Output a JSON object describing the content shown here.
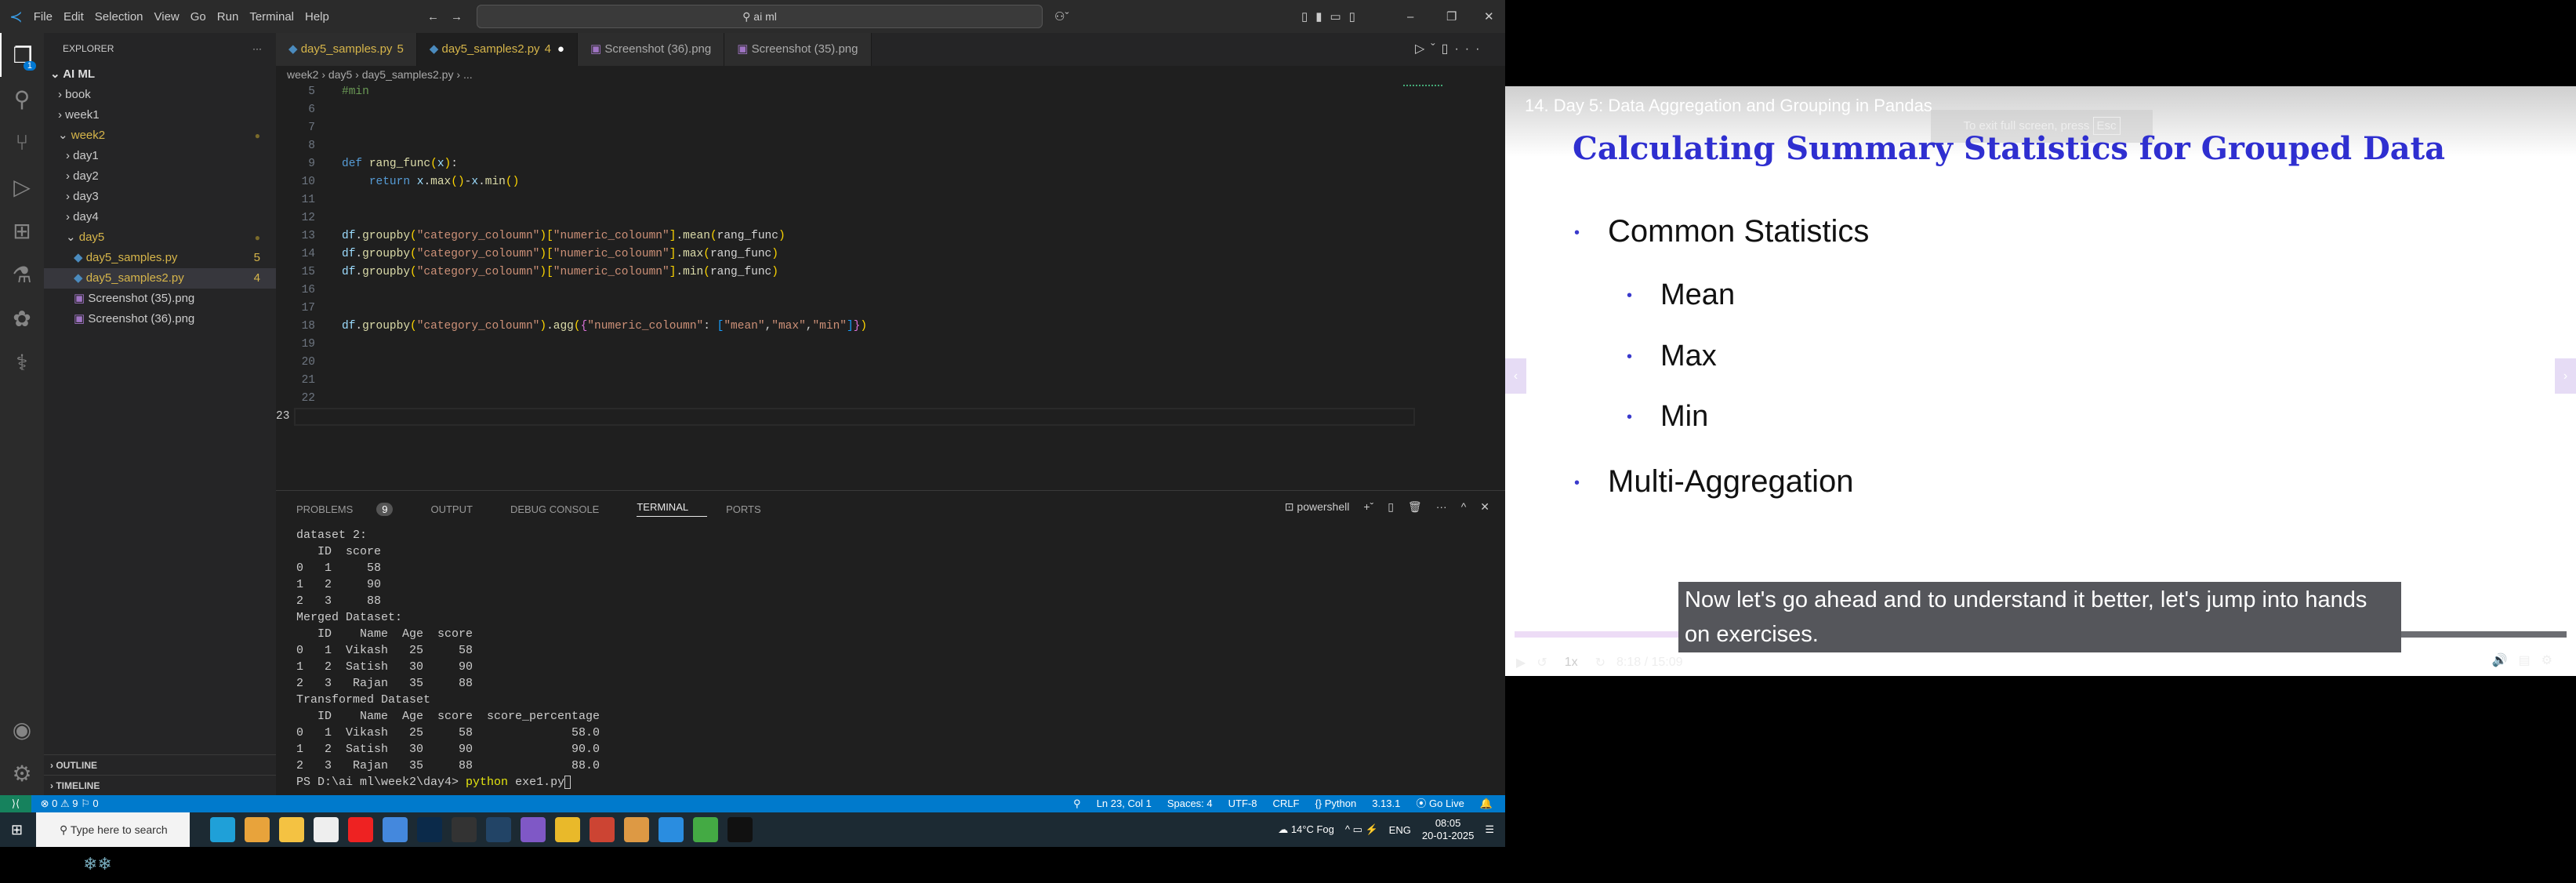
{
  "titlebar": {
    "menu": [
      "File",
      "Edit",
      "Selection",
      "View",
      "Go",
      "Run",
      "Terminal",
      "Help"
    ],
    "search": "ai ml"
  },
  "activity": {
    "explorer_badge": "1"
  },
  "sidebar": {
    "header": "EXPLORER",
    "root": "AI ML",
    "items": [
      {
        "label": "book",
        "depth": 1,
        "type": "folder",
        "open": false
      },
      {
        "label": "week1",
        "depth": 1,
        "type": "folder",
        "open": false
      },
      {
        "label": "week2",
        "depth": 1,
        "type": "folder",
        "open": true,
        "modified": true
      },
      {
        "label": "day1",
        "depth": 2,
        "type": "folder",
        "open": false
      },
      {
        "label": "day2",
        "depth": 2,
        "type": "folder",
        "open": false
      },
      {
        "label": "day3",
        "depth": 2,
        "type": "folder",
        "open": false
      },
      {
        "label": "day4",
        "depth": 2,
        "type": "folder",
        "open": false
      },
      {
        "label": "day5",
        "depth": 2,
        "type": "folder",
        "open": true,
        "modified": true
      },
      {
        "label": "day5_samples.py",
        "depth": 3,
        "type": "py",
        "count": "5"
      },
      {
        "label": "day5_samples2.py",
        "depth": 3,
        "type": "py",
        "count": "4",
        "selected": true
      },
      {
        "label": "Screenshot (35).png",
        "depth": 3,
        "type": "png"
      },
      {
        "label": "Screenshot (36).png",
        "depth": 3,
        "type": "png"
      }
    ],
    "outline": "OUTLINE",
    "timeline": "TIMELINE"
  },
  "tabs": [
    {
      "label": "day5_samples.py",
      "count": "5"
    },
    {
      "label": "day5_samples2.py",
      "count": "4",
      "active": true
    },
    {
      "label": "Screenshot (36).png"
    },
    {
      "label": "Screenshot (35).png"
    }
  ],
  "breadcrumb": [
    "week2",
    "day5",
    "day5_samples2.py",
    "..."
  ],
  "code": [
    {
      "n": "5",
      "html": "<span class='cm'>#min</span>"
    },
    {
      "n": "6",
      "html": ""
    },
    {
      "n": "7",
      "html": ""
    },
    {
      "n": "8",
      "html": ""
    },
    {
      "n": "9",
      "html": "<span class='kw'>def</span> <span class='fn'>rang_func</span><span class='b1'>(</span><span class='vr'>x</span><span class='b1'>)</span>:"
    },
    {
      "n": "10",
      "html": "    <span class='kw'>return</span> <span class='vr'>x</span>.<span class='fn'>max</span><span class='b1'>()</span>-<span class='vr'>x</span>.<span class='fn'>min</span><span class='b1'>()</span>"
    },
    {
      "n": "11",
      "html": ""
    },
    {
      "n": "12",
      "html": ""
    },
    {
      "n": "13",
      "html": "<span class='vr'>df</span>.<span class='fn'>groupby</span><span class='b1'>(</span><span class='str'>\"category_coloumn\"</span><span class='b1'>)[</span><span class='str'>\"numeric_coloumn\"</span><span class='b1'>]</span>.<span class='fn'>mean</span><span class='b1'>(</span>rang_func<span class='b1'>)</span>"
    },
    {
      "n": "14",
      "html": "<span class='vr'>df</span>.<span class='fn'>groupby</span><span class='b1'>(</span><span class='str'>\"category_coloumn\"</span><span class='b1'>)[</span><span class='str'>\"numeric_coloumn\"</span><span class='b1'>]</span>.<span class='fn'>max</span><span class='b1'>(</span>rang_func<span class='b1'>)</span>"
    },
    {
      "n": "15",
      "html": "<span class='vr'>df</span>.<span class='fn'>groupby</span><span class='b1'>(</span><span class='str'>\"category_coloumn\"</span><span class='b1'>)[</span><span class='str'>\"numeric_coloumn\"</span><span class='b1'>]</span>.<span class='fn'>min</span><span class='b1'>(</span>rang_func<span class='b1'>)</span>"
    },
    {
      "n": "16",
      "html": ""
    },
    {
      "n": "17",
      "html": ""
    },
    {
      "n": "18",
      "html": "<span class='vr'>df</span>.<span class='fn'>groupby</span><span class='b1'>(</span><span class='str'>\"category_coloumn\"</span><span class='b1'>)</span>.<span class='fn'>agg</span><span class='b1'>(</span><span class='b2'>{</span><span class='str'>\"numeric_coloumn\"</span>: <span class='b3'>[</span><span class='str'>\"mean\"</span>,<span class='str'>\"max\"</span>,<span class='str'>\"min\"</span><span class='b3'>]</span><span class='b2'>}</span><span class='b1'>)</span>"
    },
    {
      "n": "19",
      "html": ""
    },
    {
      "n": "20",
      "html": ""
    },
    {
      "n": "21",
      "html": ""
    },
    {
      "n": "22",
      "html": ""
    },
    {
      "n": "23",
      "html": "",
      "current": true
    }
  ],
  "panel": {
    "tabs": [
      "PROBLEMS",
      "OUTPUT",
      "DEBUG CONSOLE",
      "TERMINAL",
      "PORTS"
    ],
    "problems_count": "9",
    "active": "TERMINAL",
    "shell": "powershell",
    "terminal": [
      "dataset 2:",
      "   ID  score",
      "0   1     58",
      "1   2     90",
      "2   3     88",
      "Merged Dataset:",
      "   ID    Name  Age  score",
      "0   1  Vikash   25     58",
      "1   2  Satish   30     90",
      "2   3   Rajan   35     88",
      "Transformed Dataset",
      "   ID    Name  Age  score  score_percentage",
      "0   1  Vikash   25     58              58.0",
      "1   2  Satish   30     90              90.0",
      "2   3   Rajan   35     88              88.0"
    ],
    "prompt": "PS D:\\ai ml\\week2\\day4> ",
    "cmd": "python",
    "args": " exe1.py"
  },
  "status": {
    "errors": "0",
    "warnings": "9",
    "ports": "0",
    "position": "Ln 23, Col 1",
    "spaces": "Spaces: 4",
    "encoding": "UTF-8",
    "eol": "CRLF",
    "language": "Python",
    "version": "3.13.1",
    "golive": "Go Live"
  },
  "taskbar": {
    "search": "Type here to search",
    "weather": "14°C  Fog",
    "lang": "ENG",
    "time": "08:05",
    "date": "20-01-2025"
  },
  "video": {
    "course_title": "14. Day 5: Data Aggregation and Grouping in Pandas",
    "fullscreen_hint": "To exit full screen, press",
    "esc": "Esc",
    "slide_title": "Calculating Summary Statistics for Grouped Data",
    "bullets": [
      {
        "text": "Common Statistics",
        "level": 1
      },
      {
        "text": "Mean",
        "level": 2
      },
      {
        "text": "Max",
        "level": 2
      },
      {
        "text": "Min",
        "level": 2
      },
      {
        "text": "Multi-Aggregation",
        "level": 1
      }
    ],
    "caption": "Now let's go ahead and to understand it better, let's jump into hands on exercises.",
    "speed": "1x",
    "time": "8:18 / 15:09",
    "progress_percent": 54.9,
    "title_color": "#2f2fd0"
  }
}
